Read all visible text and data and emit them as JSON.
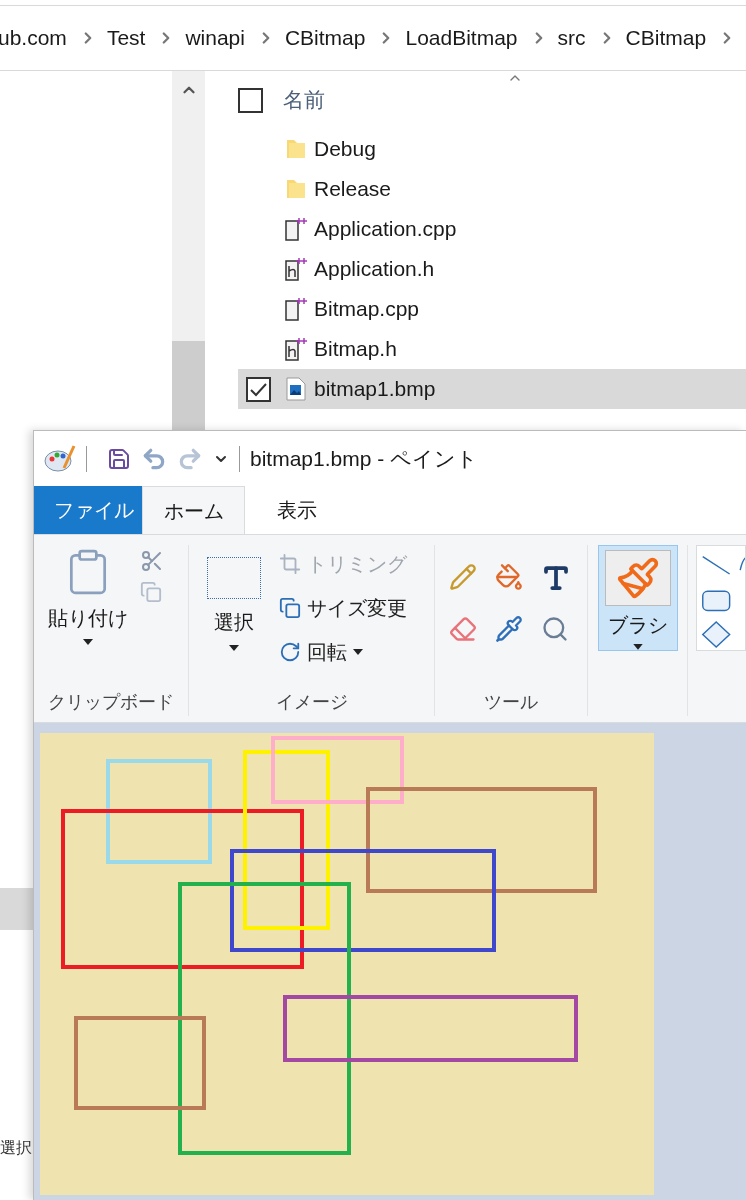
{
  "explorer": {
    "breadcrumb": [
      "ub.com",
      "Test",
      "winapi",
      "CBitmap",
      "LoadBitmap",
      "src",
      "CBitmap"
    ],
    "column_header": {
      "label": "名前",
      "checked": false
    },
    "files": [
      {
        "name": "Debug",
        "kind": "folder",
        "selected": false
      },
      {
        "name": "Release",
        "kind": "folder",
        "selected": false
      },
      {
        "name": "Application.cpp",
        "kind": "cpp",
        "selected": false
      },
      {
        "name": "Application.h",
        "kind": "header",
        "selected": false
      },
      {
        "name": "Bitmap.cpp",
        "kind": "cpp",
        "selected": false
      },
      {
        "name": "Bitmap.h",
        "kind": "header",
        "selected": false
      },
      {
        "name": "bitmap1.bmp",
        "kind": "image",
        "selected": true
      }
    ],
    "nav_pane_text": "選択"
  },
  "paint": {
    "title": "bitmap1.bmp - ペイント",
    "tabs": [
      {
        "label": "ファイル",
        "kind": "file",
        "selected": false
      },
      {
        "label": "ホーム",
        "kind": "tab",
        "selected": true
      },
      {
        "label": "表示",
        "kind": "tab",
        "selected": false
      }
    ],
    "clipboard": {
      "paste": "貼り付け",
      "group_label": "クリップボード"
    },
    "image": {
      "select": "選択",
      "actions": [
        {
          "label": "トリミング",
          "kind": "crop",
          "disabled": true
        },
        {
          "label": "サイズ変更",
          "kind": "resize",
          "disabled": false
        },
        {
          "label": "回転",
          "kind": "rotate",
          "disabled": false
        }
      ],
      "group_label": "イメージ"
    },
    "tools": {
      "group_label": "ツール"
    },
    "brush": {
      "label": "ブラシ",
      "selected": true
    }
  }
}
